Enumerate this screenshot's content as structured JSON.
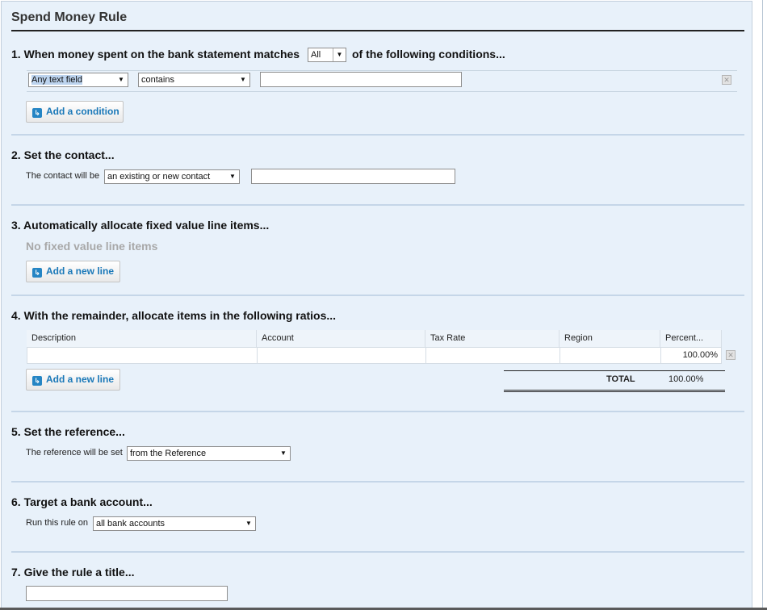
{
  "title": "Spend Money Rule",
  "sections": {
    "s1": {
      "heading_pre": "1. When money spent on the bank statement matches",
      "match_value": "All",
      "heading_post": "of the following conditions...",
      "condition": {
        "field": "Any text field",
        "operator": "contains",
        "value": ""
      },
      "add_button": "Add a condition"
    },
    "s2": {
      "heading": "2. Set the contact...",
      "label": "The contact will be",
      "select": "an existing or new contact",
      "value": ""
    },
    "s3": {
      "heading": "3. Automatically allocate fixed value line items...",
      "empty_text": "No fixed value line items",
      "add_button": "Add a new line"
    },
    "s4": {
      "heading": "4. With the remainder, allocate items in the following ratios...",
      "columns": [
        "Description",
        "Account",
        "Tax Rate",
        "Region",
        "Percent..."
      ],
      "row": {
        "description": "",
        "account": "",
        "tax_rate": "",
        "region": "",
        "percent": "100.00%"
      },
      "add_button": "Add a new line",
      "total_label": "TOTAL",
      "total_value": "100.00%"
    },
    "s5": {
      "heading": "5. Set the reference...",
      "label": "The reference will be set",
      "select": "from the Reference"
    },
    "s6": {
      "heading": "6. Target a bank account...",
      "label": "Run this rule on",
      "select": "all bank accounts"
    },
    "s7": {
      "heading": "7. Give the rule a title...",
      "value": ""
    }
  },
  "icons": {
    "add": "add-icon",
    "delete": "delete-icon",
    "dropdown": "chevron-down-icon"
  },
  "colors": {
    "panel": "#e8f1fa",
    "link": "#1a78b8",
    "separator": "#c5d6e8"
  }
}
